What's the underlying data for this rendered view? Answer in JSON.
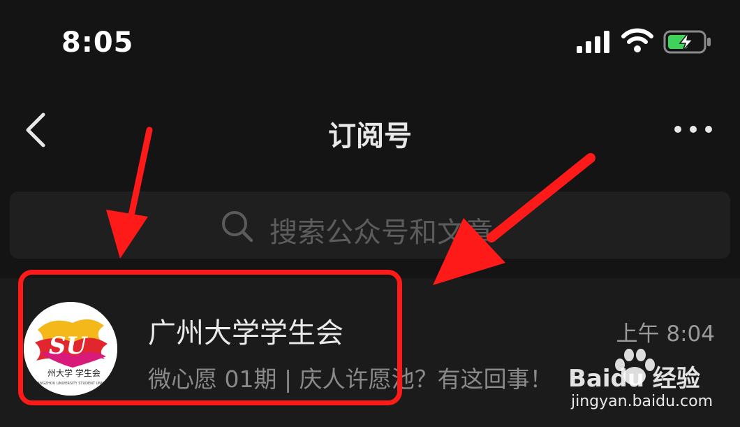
{
  "status_bar": {
    "time": "8:05",
    "icons": [
      "signal-icon",
      "wifi-icon",
      "battery-charging-icon"
    ],
    "battery_color": "#3fd15a"
  },
  "nav": {
    "title": "订阅号",
    "back_icon": "chevron-left-icon",
    "more_icon": "more-dots-icon"
  },
  "search": {
    "placeholder": "搜索公众号和文章",
    "icon": "search-icon"
  },
  "list": [
    {
      "name": "广州大学学生会",
      "time": "上午 8:04",
      "preview": "微心愿 01期 | 庆人许愿池？有这回事！",
      "avatar_text": "州大学 学生会",
      "avatar_subtext": "GUANGZHOU UNIVERSITY STUDENT UNION"
    }
  ],
  "annotation": {
    "color": "#ff1a1a"
  },
  "watermark": {
    "logo": "Baidu 经验",
    "url": "jingyan.baidu.com"
  }
}
